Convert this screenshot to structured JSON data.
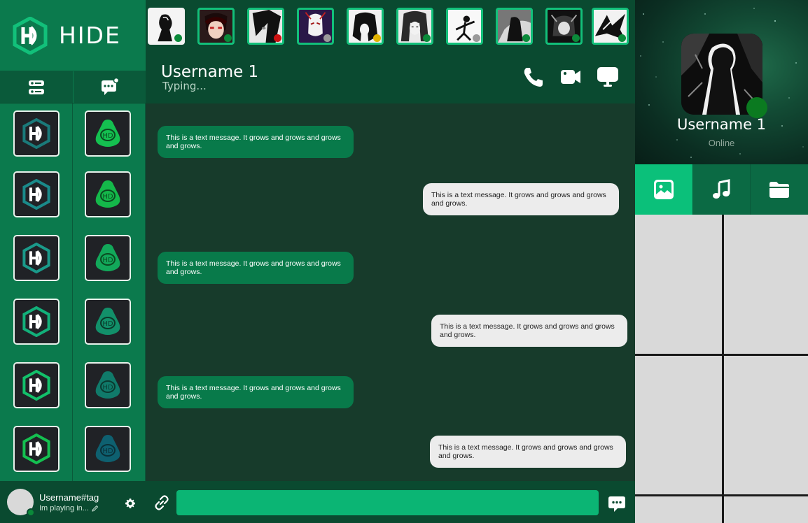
{
  "brand": {
    "name": "HIDE"
  },
  "colors": {
    "accent": "#0bc07a",
    "primary_green": "#0b7a4d",
    "dark_green": "#0a4a30",
    "chat_bg": "#173b2b",
    "online": "#0b8a3a",
    "busy": "#cc1111",
    "away": "#e2b400",
    "offline": "#9a9a9a"
  },
  "sidebar": {
    "mode_tabs": [
      {
        "icon": "server-icon"
      },
      {
        "icon": "chat-bubble-icon"
      }
    ],
    "servers_left": [
      "hd-logo-icon",
      "hd-logo-icon",
      "hd-logo-icon",
      "hd-logo-icon",
      "hd-logo-icon",
      "hd-logo-icon"
    ],
    "servers_right": [
      "hd-blob-icon",
      "hd-blob-icon",
      "hd-blob-icon",
      "hd-blob-icon",
      "hd-blob-icon",
      "hd-blob-icon"
    ]
  },
  "self": {
    "name": "Username#tag",
    "status": "Im playing in...",
    "presence": "online"
  },
  "stories": [
    {
      "presence": "online"
    },
    {
      "presence": "online"
    },
    {
      "presence": "busy"
    },
    {
      "presence": "offline"
    },
    {
      "presence": "away"
    },
    {
      "presence": "online"
    },
    {
      "presence": "offline"
    },
    {
      "presence": "online"
    },
    {
      "presence": "online"
    },
    {
      "presence": "online"
    }
  ],
  "chat": {
    "title": "Username 1",
    "subtitle": "Typing...",
    "actions": [
      "phone-icon",
      "video-camera-icon",
      "screen-share-icon"
    ],
    "messages": [
      {
        "dir": "in",
        "text": "This is a text message. It grows and grows and grows and grows."
      },
      {
        "dir": "out",
        "text": "This is a text message. It grows and grows and grows and grows."
      },
      {
        "dir": "in",
        "text": "This is a text message. It grows and grows and grows and grows."
      },
      {
        "dir": "out",
        "text": "This is a text message. It grows and grows and grows and grows."
      },
      {
        "dir": "in",
        "text": "This is a text message. It grows and grows and grows and grows."
      },
      {
        "dir": "out",
        "text": "This is a text message. It grows and grows and grows and grows."
      }
    ]
  },
  "composer": {
    "value": "",
    "placeholder": ""
  },
  "profile": {
    "name": "Username 1",
    "status": "Online"
  },
  "media_tabs": [
    {
      "icon": "image-icon",
      "active": true
    },
    {
      "icon": "music-note-icon",
      "active": false
    },
    {
      "icon": "folder-icon",
      "active": false
    }
  ]
}
